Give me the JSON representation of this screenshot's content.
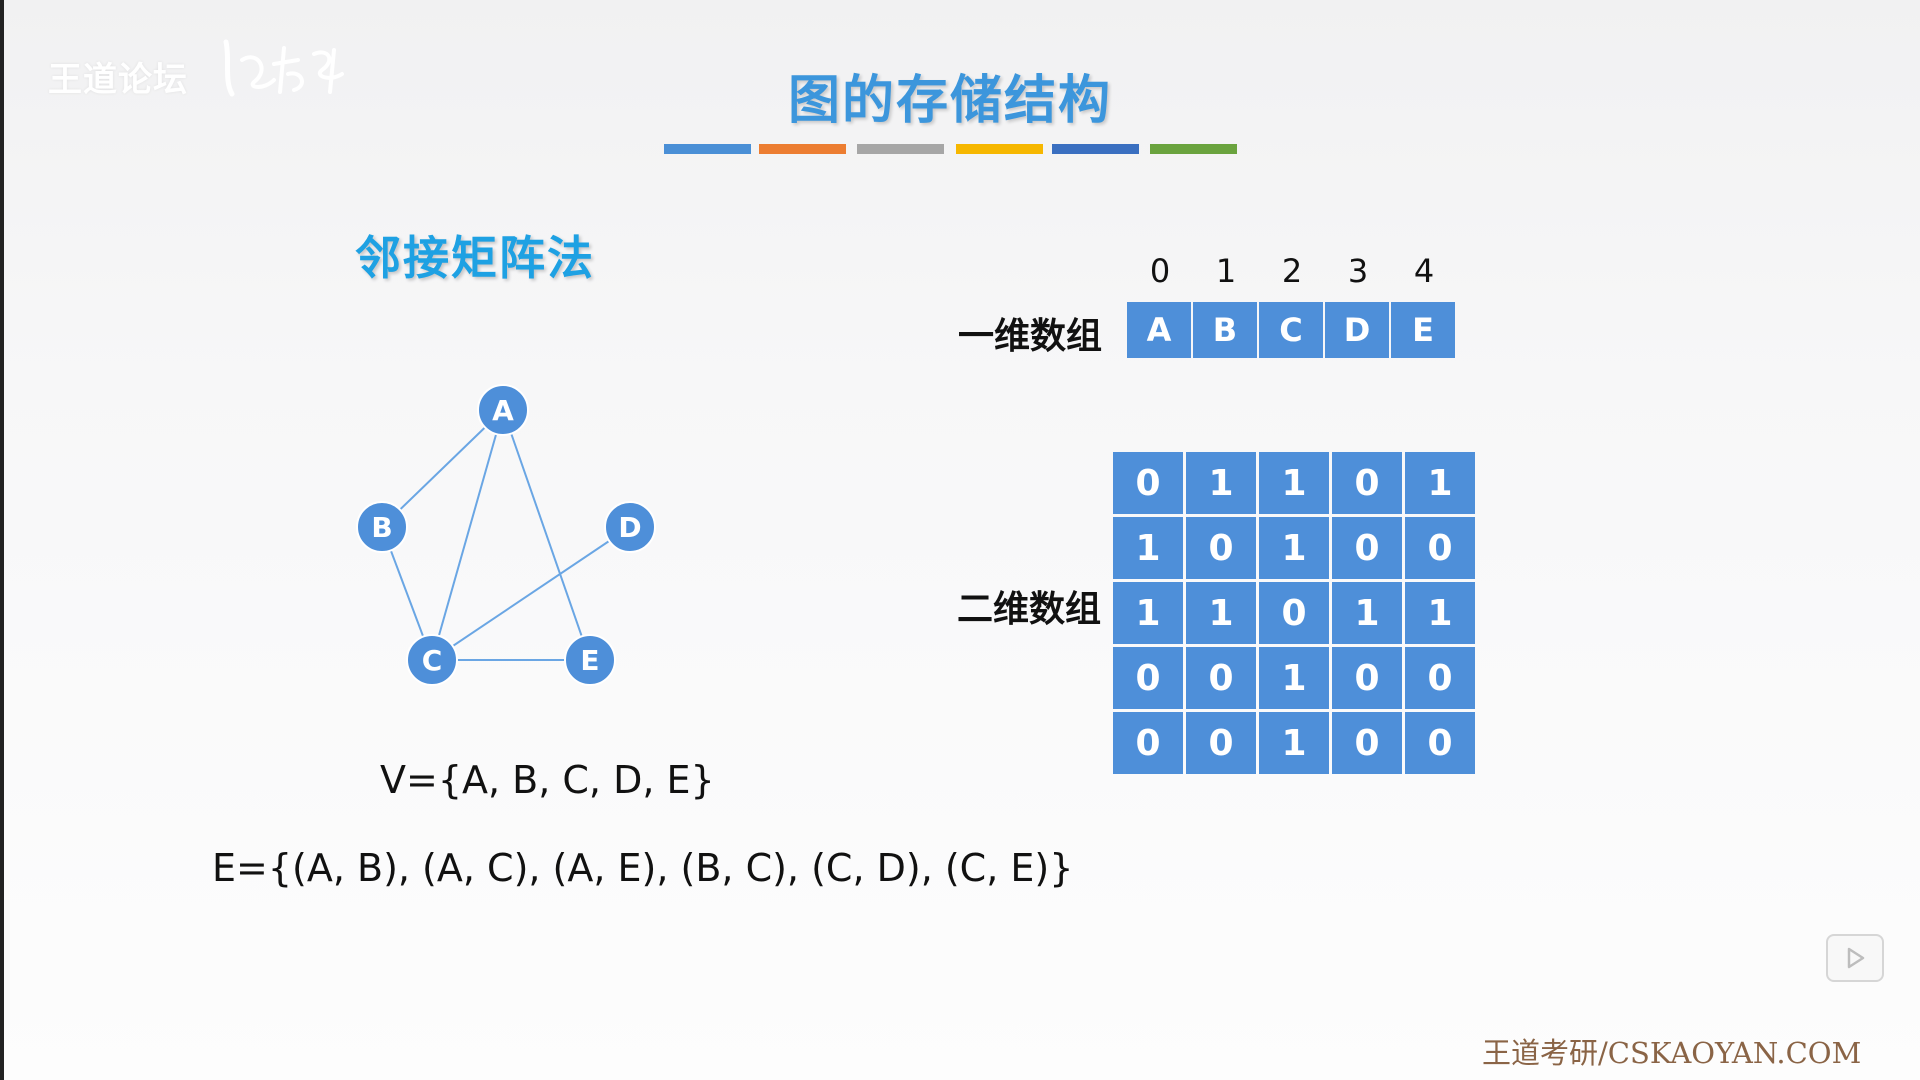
{
  "watermark_top": "王道论坛",
  "title": "图的存储结构",
  "title_bar_colors": [
    "#4a8fd6",
    "#ec7d31",
    "#a6a6a6",
    "#f6b700",
    "#3a6fc0",
    "#6aa33e"
  ],
  "section_heading": "邻接矩阵法",
  "graph": {
    "vertices": [
      {
        "id": "A",
        "label": "A"
      },
      {
        "id": "B",
        "label": "B"
      },
      {
        "id": "C",
        "label": "C"
      },
      {
        "id": "D",
        "label": "D"
      },
      {
        "id": "E",
        "label": "E"
      }
    ],
    "edges": [
      [
        "A",
        "B"
      ],
      [
        "A",
        "C"
      ],
      [
        "A",
        "E"
      ],
      [
        "B",
        "C"
      ],
      [
        "C",
        "D"
      ],
      [
        "C",
        "E"
      ]
    ],
    "vertex_color": "#4e8fd9",
    "edge_color": "#6aa6e4"
  },
  "vertex_set": "V={A, B, C, D, E}",
  "edge_set": "E={(A, B), (A, C), (A, E), (B, C), (C, D), (C, E)}",
  "array_1d": {
    "label": "一维数组",
    "indices": [
      "0",
      "1",
      "2",
      "3",
      "4"
    ],
    "values": [
      "A",
      "B",
      "C",
      "D",
      "E"
    ]
  },
  "array_2d": {
    "label": "二维数组",
    "rows": [
      [
        "0",
        "1",
        "1",
        "0",
        "1"
      ],
      [
        "1",
        "0",
        "1",
        "0",
        "0"
      ],
      [
        "1",
        "1",
        "0",
        "1",
        "1"
      ],
      [
        "0",
        "0",
        "1",
        "0",
        "0"
      ],
      [
        "0",
        "0",
        "1",
        "0",
        "0"
      ]
    ]
  },
  "cell_color": "#4e8fd9",
  "play_icon": "play-icon",
  "watermark_bottom": "王道考研/CSKAOYAN.COM"
}
